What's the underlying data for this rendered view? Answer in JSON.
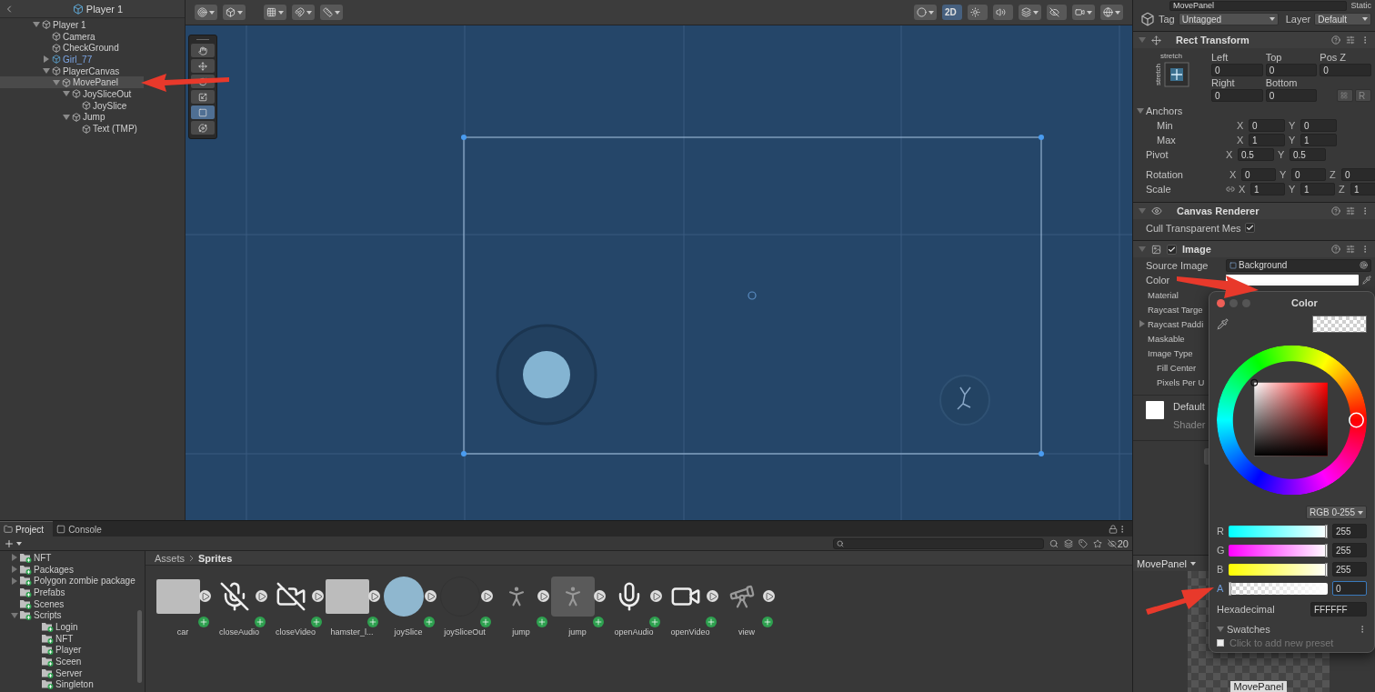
{
  "hierarchy": {
    "title": "Player 1",
    "items": [
      {
        "label": "Player 1",
        "kind": "object",
        "expanded": true,
        "selected": false,
        "children": [
          {
            "label": "Camera",
            "kind": "object",
            "selected": false
          },
          {
            "label": "CheckGround",
            "kind": "object",
            "selected": false
          },
          {
            "label": "Girl_77",
            "kind": "prefab",
            "expanded": false,
            "selected": false
          },
          {
            "label": "PlayerCanvas",
            "kind": "object",
            "expanded": true,
            "selected": false,
            "children": [
              {
                "label": "MovePanel",
                "kind": "object",
                "expanded": true,
                "selected": true,
                "children": [
                  {
                    "label": "JoySliceOut",
                    "kind": "object",
                    "expanded": true,
                    "selected": false,
                    "children": [
                      {
                        "label": "JoySlice",
                        "kind": "object",
                        "selected": false
                      }
                    ]
                  },
                  {
                    "label": "Jump",
                    "kind": "object",
                    "expanded": true,
                    "selected": false,
                    "children": [
                      {
                        "label": "Text (TMP)",
                        "kind": "object",
                        "selected": false
                      }
                    ]
                  }
                ]
              }
            ]
          }
        ]
      }
    ]
  },
  "scene": {
    "mode_button": {
      "label": "2D",
      "selected": true
    },
    "tools": [
      {
        "selected": false
      },
      {
        "selected": false
      },
      {
        "selected": false
      },
      {
        "selected": false
      },
      {
        "selected": true
      },
      {
        "selected": false
      }
    ]
  },
  "inspector": {
    "name": "MovePanel",
    "static_label": "Static",
    "tag_label": "Tag",
    "tag": "Untagged",
    "layer_label": "Layer",
    "layer": "Default",
    "rect_transform": {
      "title": "Rect Transform",
      "expanded": true,
      "preset_h": "stretch",
      "preset_v": "stretch",
      "offsets": [
        {
          "label": "Left",
          "value": "0"
        },
        {
          "label": "Top",
          "value": "0"
        },
        {
          "label": "Pos Z",
          "value": "0"
        },
        {
          "label": "Right",
          "value": "0"
        },
        {
          "label": "Bottom",
          "value": "0"
        }
      ],
      "raw_button": "R",
      "anchors": {
        "label": "Anchors",
        "expanded": true,
        "rows": [
          {
            "label": "Min",
            "fields": [
              {
                "axis": "X",
                "value": "0"
              },
              {
                "axis": "Y",
                "value": "0"
              }
            ]
          },
          {
            "label": "Max",
            "fields": [
              {
                "axis": "X",
                "value": "1"
              },
              {
                "axis": "Y",
                "value": "1"
              }
            ]
          }
        ]
      },
      "rows": [
        {
          "label": "Pivot",
          "fields": [
            {
              "axis": "X",
              "value": "0.5"
            },
            {
              "axis": "Y",
              "value": "0.5"
            }
          ]
        },
        {
          "label": "Rotation",
          "fields": [
            {
              "axis": "X",
              "value": "0"
            },
            {
              "axis": "Y",
              "value": "0"
            },
            {
              "axis": "Z",
              "value": "0"
            }
          ]
        },
        {
          "label": "Scale",
          "proportional_toggle": true,
          "fields": [
            {
              "axis": "X",
              "value": "1"
            },
            {
              "axis": "Y",
              "value": "1"
            },
            {
              "axis": "Z",
              "value": "1"
            }
          ]
        }
      ]
    },
    "canvas_renderer": {
      "title": "Canvas Renderer",
      "expanded": true,
      "toggle_label": "Cull Transparent Mes",
      "checked": true
    },
    "image": {
      "title": "Image",
      "expanded": true,
      "enabled": true,
      "source_label": "Source Image",
      "source": "Background",
      "color_label": "Color",
      "labels": [
        {
          "label": "Material",
          "indent": false
        },
        {
          "label": "Raycast Targe",
          "indent": false
        },
        {
          "label": "Raycast Paddi",
          "indent": false,
          "expandable": true
        },
        {
          "label": "Maskable",
          "indent": false
        },
        {
          "label": "Image Type",
          "indent": false
        },
        {
          "label": "Fill Center",
          "indent": true
        },
        {
          "label": "Pixels Per U",
          "indent": true
        }
      ]
    },
    "material": {
      "name": "Default",
      "shader_label": "Shader"
    },
    "preview": {
      "title": "MovePanel",
      "label": "MovePanel"
    }
  },
  "color_picker": {
    "title": "Color",
    "mode": "RGB 0-255",
    "channels": [
      {
        "label": "R",
        "level": 1,
        "value": "255",
        "focused": false
      },
      {
        "label": "G",
        "level": 1,
        "value": "255",
        "focused": false
      },
      {
        "label": "B",
        "level": 1,
        "value": "255",
        "focused": false
      },
      {
        "label": "A",
        "level": 0,
        "value": "0",
        "focused": true
      }
    ],
    "hex_label": "Hexadecimal",
    "hex": "FFFFFF",
    "swatches_label": "Swatches",
    "swatches_hint": "Click to add new preset"
  },
  "project": {
    "tabs": [
      {
        "label": "Project",
        "selected": true
      },
      {
        "label": "Console",
        "selected": false
      }
    ],
    "asset_count": "20",
    "folders": [
      {
        "label": "NFT",
        "expanded": false
      },
      {
        "label": "Packages",
        "expanded": false
      },
      {
        "label": "Polygon zombie package",
        "expanded": false
      },
      {
        "label": "Prefabs"
      },
      {
        "label": "Scenes"
      },
      {
        "label": "Scripts",
        "expanded": true,
        "children": [
          {
            "label": "Login"
          },
          {
            "label": "NFT"
          },
          {
            "label": "Player"
          },
          {
            "label": "Sceen"
          },
          {
            "label": "Server"
          },
          {
            "label": "Singleton"
          }
        ]
      }
    ],
    "breadcrumb": [
      {
        "label": "Assets"
      },
      {
        "label": "Sprites"
      }
    ],
    "assets": [
      {
        "label": "car",
        "kind": "photo",
        "selected": false
      },
      {
        "label": "closeAudio",
        "kind": "mic-off",
        "selected": false
      },
      {
        "label": "closeVideo",
        "kind": "video-off",
        "selected": false
      },
      {
        "label": "hamster_l...",
        "kind": "photo",
        "selected": false
      },
      {
        "label": "joySlice",
        "kind": "disc",
        "selected": false
      },
      {
        "label": "joySliceOut",
        "kind": "ring",
        "selected": false
      },
      {
        "label": "jump",
        "kind": "figure",
        "selected": false
      },
      {
        "label": "jump",
        "kind": "figure",
        "selected": true
      },
      {
        "label": "openAudio",
        "kind": "mic",
        "selected": false
      },
      {
        "label": "openVideo",
        "kind": "video",
        "selected": false
      },
      {
        "label": "view",
        "kind": "telescope",
        "selected": false
      }
    ]
  }
}
